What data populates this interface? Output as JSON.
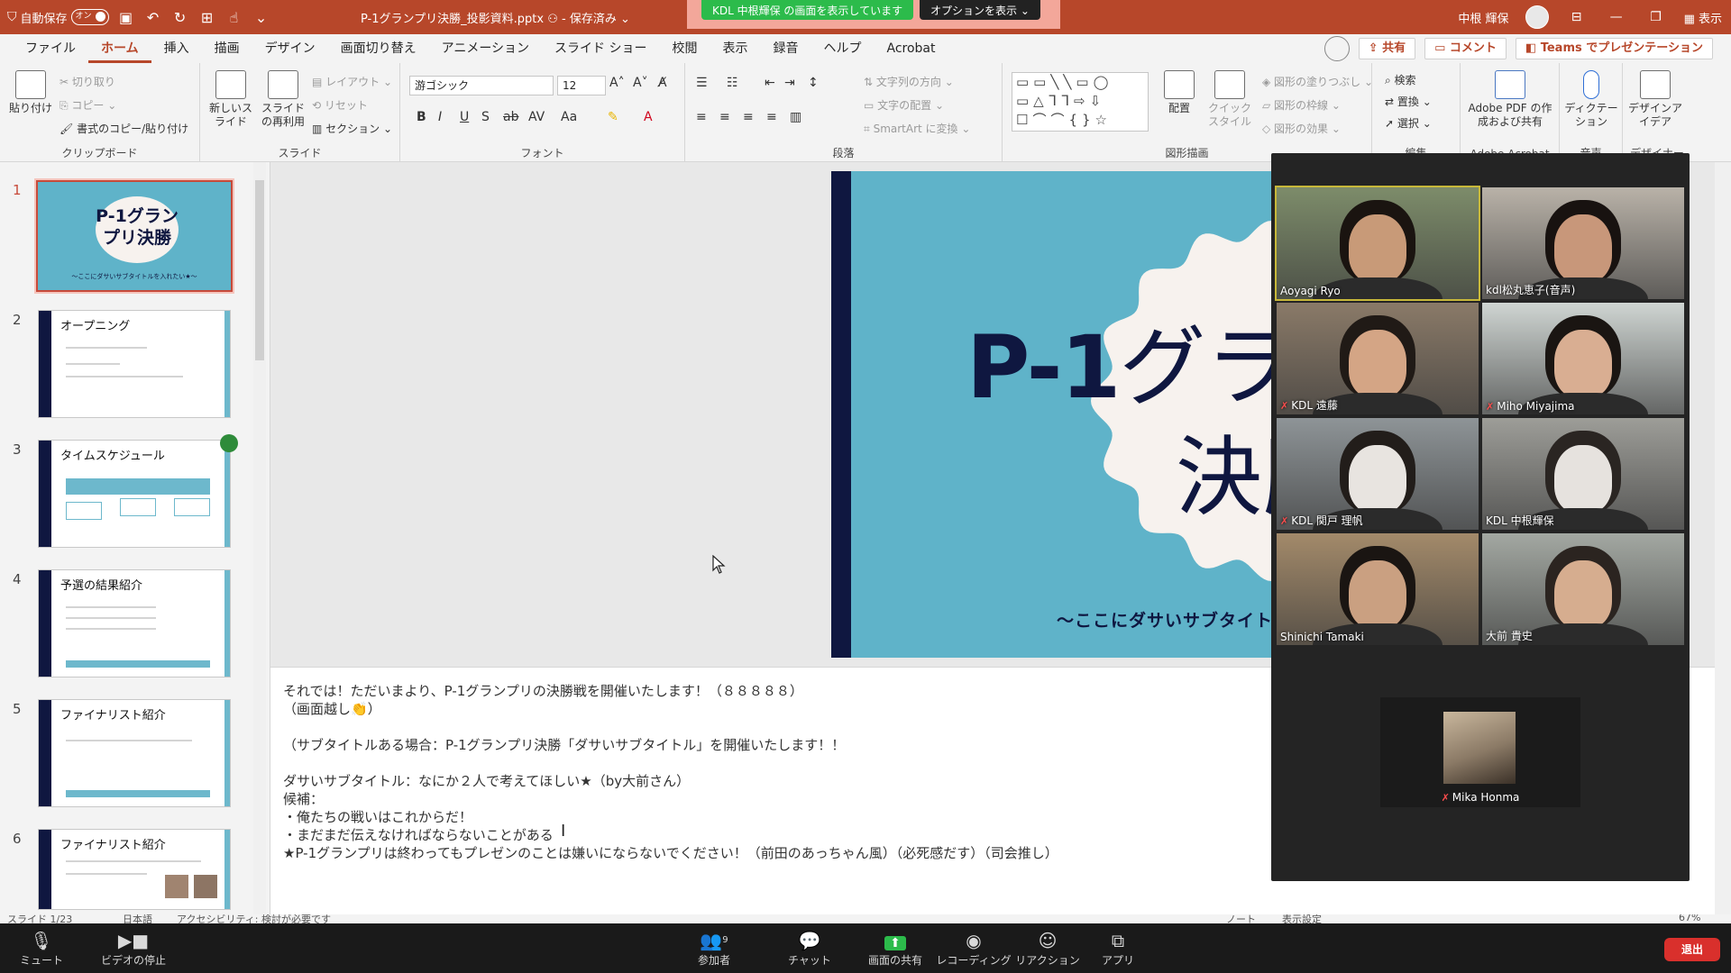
{
  "titlebar": {
    "autosave_label": "自動保存",
    "autosave_state": "オン",
    "document_title": "P-1グランプリ決勝_投影資料.pptx",
    "save_state": "保存済み",
    "share_notice": "KDL 中根輝保 の画面を表示しています",
    "options_label": "オプションを表示",
    "user_name": "中根 輝保",
    "view_label": "表示"
  },
  "menu": {
    "tabs": [
      "ファイル",
      "ホーム",
      "挿入",
      "描画",
      "デザイン",
      "画面切り替え",
      "アニメーション",
      "スライド ショー",
      "校閲",
      "表示",
      "録音",
      "ヘルプ",
      "Acrobat"
    ],
    "share_label": "共有",
    "comment_label": "コメント",
    "teams_label": "Teams でプレゼンテーション"
  },
  "ribbon": {
    "clipboard": {
      "paste": "貼り付け",
      "cut": "切り取り",
      "copy": "コピー",
      "format_painter": "書式のコピー/貼り付け",
      "group": "クリップボード"
    },
    "slides": {
      "new_slide": "新しいスライド",
      "reuse": "スライドの再利用",
      "layout": "レイアウト",
      "reset": "リセット",
      "section": "セクション",
      "group": "スライド"
    },
    "font": {
      "name": "游ゴシック",
      "size": "12",
      "group": "フォント"
    },
    "paragraph": {
      "text_direction": "文字列の方向",
      "align_text": "文字の配置",
      "smartart": "SmartArt に変換",
      "group": "段落"
    },
    "drawing": {
      "arrange": "配置",
      "quick_styles": "クイックスタイル",
      "shape_fill": "図形の塗りつぶし",
      "shape_outline": "図形の枠線",
      "shape_effects": "図形の効果",
      "group": "図形描画"
    },
    "editing": {
      "find": "検索",
      "replace": "置換",
      "select": "選択",
      "group": "編集"
    },
    "acrobat": {
      "create_pdf": "Adobe PDF の作成および共有",
      "group": "Adobe Acrobat"
    },
    "voice": {
      "dictate": "ディクテーション",
      "group": "音声"
    },
    "designer": {
      "ideas": "デザインアイデア",
      "group": "デザイナー"
    }
  },
  "thumbnails": [
    {
      "num": "1",
      "title": "P-1グランプリ決勝",
      "subtitle": "～ここにダサいサブタイトルを入れたい★～"
    },
    {
      "num": "2",
      "title": "オープニング"
    },
    {
      "num": "3",
      "title": "タイムスケジュール"
    },
    {
      "num": "4",
      "title": "予選の結果紹介"
    },
    {
      "num": "5",
      "title": "ファイナリスト紹介"
    },
    {
      "num": "6",
      "title": "ファイナリスト紹介"
    }
  ],
  "slide": {
    "title_bold": "P-1",
    "title_rest": "グランプリ",
    "title_line2": "決勝",
    "subtitle": "～ここにダサいサブタイトルを入れたい★～"
  },
  "notes": [
    "それでは！ただいまより、P-1グランプリの決勝戦を開催いたします！（８８８８８）",
    "（画面越し👏）",
    "",
    "（サブタイトルある場合：P-1グランプリ決勝「ダサいサブタイトル」を開催いたします！！",
    "",
    "ダサいサブタイトル：なにか２人で考えてほしい★（by大前さん）",
    "候補：",
    "・俺たちの戦いはこれからだ！",
    "・まだまだ伝えなければならないことがある",
    "★P-1グランプリは終わってもプレゼンのことは嫌いにならないでください！（前田のあっちゃん風）（必死感だす）（司会推し）"
  ],
  "participants": [
    {
      "name": "Aoyagi Ryo",
      "muted": false,
      "bg": "#7d8c6a",
      "skin": "#c89a78",
      "hair": "#1a1410"
    },
    {
      "name": "kdl松丸恵子(音声)",
      "muted": false,
      "bg": "#b9b2a8",
      "skin": "#c8977a",
      "hair": "#181210"
    },
    {
      "name": "KDL 遠藤",
      "muted": true,
      "bg": "#8a7a68",
      "skin": "#d4a585",
      "hair": "#201a16"
    },
    {
      "name": "Miho Miyajima",
      "muted": true,
      "bg": "#cfd5d2",
      "skin": "#d9ae92",
      "hair": "#1a1512"
    },
    {
      "name": "KDL 関戸 理帆",
      "muted": true,
      "bg": "#8e9497",
      "skin": "#e8e4e0",
      "hair": "#221d1a"
    },
    {
      "name": "KDL 中根輝保",
      "muted": false,
      "bg": "#9d9d98",
      "skin": "#e6e2de",
      "hair": "#2a2522"
    },
    {
      "name": "Shinichi Tamaki",
      "muted": false,
      "bg": "#a38a6a",
      "skin": "#caa081",
      "hair": "#1a1512"
    },
    {
      "name": "大前 貴史",
      "muted": false,
      "bg": "#a3a8a2",
      "skin": "#d6ad8f",
      "hair": "#2b2420"
    }
  ],
  "lone_participant": {
    "name": "Mika Honma",
    "muted": true
  },
  "statusbar": {
    "slide_count": "スライド 1/23",
    "language": "日本語",
    "accessibility": "アクセシビリティ: 検討が必要です",
    "notes": "ノート",
    "display_settings": "表示設定",
    "zoom": "67%"
  },
  "zoombar": {
    "mute": "ミュート",
    "stop_video": "ビデオの停止",
    "participants": "参加者",
    "participants_count": "9",
    "chat": "チャット",
    "share_screen": "画面の共有",
    "recording": "レコーディング",
    "reaction": "リアクション",
    "apps": "アプリ",
    "leave": "退出"
  },
  "colors": {
    "accent": "#b7472a",
    "slide_bg": "#5fb3c9",
    "navy": "#0f1740",
    "zoom_bg": "#242424",
    "leave": "#d9302c"
  }
}
